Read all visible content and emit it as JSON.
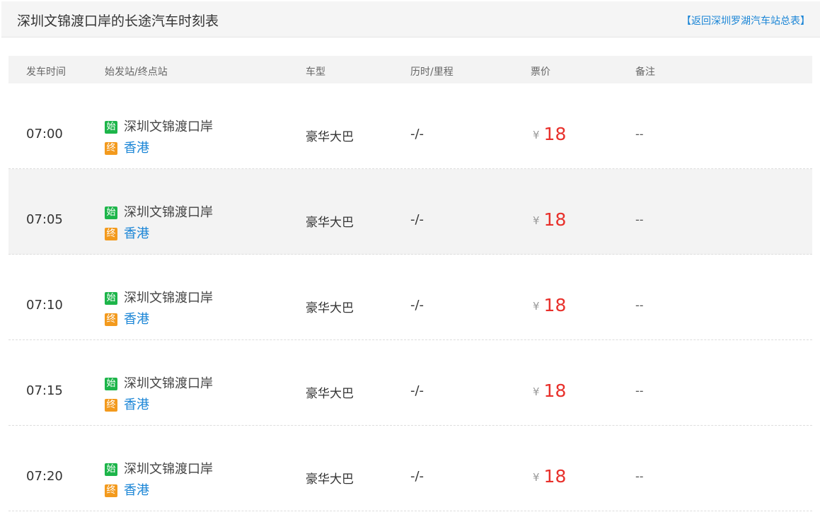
{
  "header": {
    "title": "深圳文锦渡口岸的长途汽车时刻表",
    "back_link": "【返回深圳罗湖汽车站总表】"
  },
  "table": {
    "columns": [
      "发车时间",
      "始发站/终点站",
      "车型",
      "历时/里程",
      "票价",
      "备注"
    ],
    "start_tag": "始",
    "end_tag": "终",
    "currency": "¥",
    "rows": [
      {
        "time": "07:00",
        "origin": "深圳文锦渡口岸",
        "destination": "香港",
        "bus_type": "豪华大巴",
        "duration": "-/-",
        "price": "18",
        "note": "--"
      },
      {
        "time": "07:05",
        "origin": "深圳文锦渡口岸",
        "destination": "香港",
        "bus_type": "豪华大巴",
        "duration": "-/-",
        "price": "18",
        "note": "--"
      },
      {
        "time": "07:10",
        "origin": "深圳文锦渡口岸",
        "destination": "香港",
        "bus_type": "豪华大巴",
        "duration": "-/-",
        "price": "18",
        "note": "--"
      },
      {
        "time": "07:15",
        "origin": "深圳文锦渡口岸",
        "destination": "香港",
        "bus_type": "豪华大巴",
        "duration": "-/-",
        "price": "18",
        "note": "--"
      },
      {
        "time": "07:20",
        "origin": "深圳文锦渡口岸",
        "destination": "香港",
        "bus_type": "豪华大巴",
        "duration": "-/-",
        "price": "18",
        "note": "--"
      }
    ]
  },
  "colors": {
    "start_tag": "#1db54a",
    "end_tag": "#f39a1d",
    "price": "#e8302b",
    "link": "#1a85d6"
  }
}
